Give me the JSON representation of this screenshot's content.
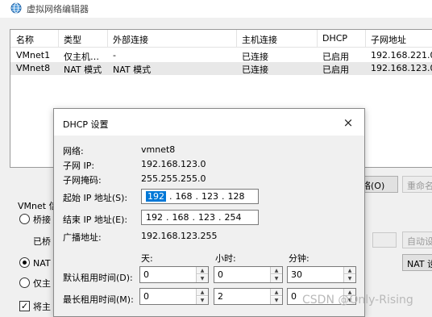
{
  "window": {
    "title": "虚拟网络编辑器"
  },
  "table": {
    "columns": [
      "名称",
      "类型",
      "外部连接",
      "主机连接",
      "DHCP",
      "子网地址"
    ],
    "rows": [
      {
        "name": "VMnet1",
        "type": "仅主机…",
        "external": "-",
        "host": "已连接",
        "dhcp": "已启用",
        "subnet": "192.168.221.0"
      },
      {
        "name": "VMnet8",
        "type": "NAT 模式",
        "external": "NAT 模式",
        "host": "已连接",
        "dhcp": "已启用",
        "subnet": "192.168.123.0"
      }
    ]
  },
  "buttons": {
    "partial_1": "络(O)",
    "rename": "重命名",
    "auto_settings": "自动设",
    "nat_settings": "NAT 设"
  },
  "vmnet_group": {
    "label": "VMnet 信",
    "bridged": "桥接",
    "bridged_to": "已桥",
    "nat": "NAT 枝",
    "host_only": "仅主",
    "connect_host": "将主"
  },
  "dialog": {
    "title": "DHCP 设置",
    "close": "×",
    "network_label": "网络:",
    "network_value": "vmnet8",
    "subnet_ip_label": "子网 IP:",
    "subnet_ip_value": "192.168.123.0",
    "subnet_mask_label": "子网掩码:",
    "subnet_mask_value": "255.255.255.0",
    "start_ip_label": "起始 IP 地址(S):",
    "start_ip": [
      "192",
      "168",
      "123",
      "128"
    ],
    "end_ip_label": "结束 IP 地址(E):",
    "end_ip": [
      "192",
      "168",
      "123",
      "254"
    ],
    "broadcast_label": "广播地址:",
    "broadcast_value": "192.168.123.255",
    "lease_headers": {
      "days": "天:",
      "hours": "小时:",
      "minutes": "分钟:"
    },
    "default_lease": {
      "label": "默认租用时间(D):",
      "days": "0",
      "hours": "0",
      "minutes": "30"
    },
    "max_lease": {
      "label": "最长租用时间(M):",
      "days": "0",
      "hours": "2",
      "minutes": "0"
    }
  },
  "watermark": "CSDN @Only-Rising",
  "icons": {
    "globe": "globe-icon",
    "close": "close-icon",
    "spin_up": "chevron-up-icon",
    "spin_down": "chevron-down-icon",
    "checkbox_check": "check-icon"
  },
  "colors": {
    "selection": "#0078d7",
    "row_highlight": "#e8e8e8",
    "watermark": "#b9b9b9"
  }
}
